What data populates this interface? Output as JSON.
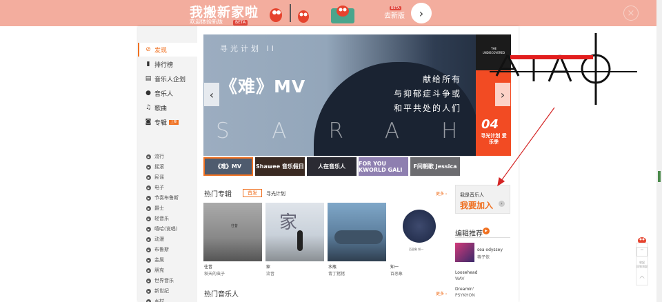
{
  "banner": {
    "title": "我搬新家啦",
    "subtitle": "欢迎体验新版",
    "beta": "BETA",
    "new_version": "去新版",
    "beta2": "BETA",
    "go_icon": "arrow-right-icon",
    "close_icon": "close-icon"
  },
  "nav": {
    "items": [
      {
        "label": "发现",
        "icon": "compass-icon"
      },
      {
        "label": "排行榜",
        "icon": "chart-icon"
      },
      {
        "label": "音乐人企划",
        "icon": "document-icon"
      },
      {
        "label": "音乐人",
        "icon": "person-icon"
      },
      {
        "label": "歌曲",
        "icon": "note-icon"
      },
      {
        "label": "专辑",
        "icon": "album-icon",
        "badge": "上新"
      }
    ],
    "genres": [
      "流行",
      "摇滚",
      "民谣",
      "电子",
      "节奏布鲁斯",
      "爵士",
      "轻音乐",
      "嘻哈(说唱)",
      "动漫",
      "布鲁斯",
      "金属",
      "朋克",
      "世界音乐",
      "新世纪",
      "乡村"
    ]
  },
  "hero": {
    "plan": "寻光计划 II",
    "title": "《难》MV",
    "line1": "献给所有",
    "line2": "与抑郁症斗争或",
    "line3": "和平共处的人们",
    "sarah": "SARAH",
    "side_tag": "THE UNDISCOVERED",
    "side_num": "04",
    "side_caption": "寻光计划 爱乐季",
    "prev_icon": "chevron-left-icon",
    "next_icon": "chevron-right-icon"
  },
  "thumbs": [
    "《难》MV",
    "Shawee 音乐假日",
    "人在音乐人",
    "FOR YOU KWORLD GALI",
    "F间朝歌 Jessica"
  ],
  "hot_albums": {
    "title": "热门专辑",
    "tab_active": "首发",
    "tab_other": "寻光计划",
    "more": "更多",
    "albums": [
      {
        "name": "往昔",
        "artist": "秋天的虫子"
      },
      {
        "name": "家",
        "artist": "流音"
      },
      {
        "name": "水瓶",
        "artist": "青丁猪猪"
      },
      {
        "name": "知一",
        "artist": "百恶象"
      }
    ],
    "cover_caption": "百恶象 知一"
  },
  "hot_musicians": {
    "title": "热门音乐人",
    "more": "更多"
  },
  "join": {
    "sub": "我是音乐人",
    "main": "我要加入"
  },
  "editor": {
    "title": "编辑推荐",
    "items": [
      {
        "name": "sea odyssey",
        "artist": "蒋子依"
      },
      {
        "name": "Loosehead",
        "artist": "WAV"
      },
      {
        "name": "Dreamin'",
        "artist": "PSYKHON"
      }
    ]
  },
  "float_tool": [
    "收起",
    "回到顶部"
  ],
  "annotation": {
    "text": "AIAO"
  },
  "colors": {
    "accent": "#f07020",
    "banner_bg": "#f3ad9e",
    "hero_side": "#f24b23"
  }
}
